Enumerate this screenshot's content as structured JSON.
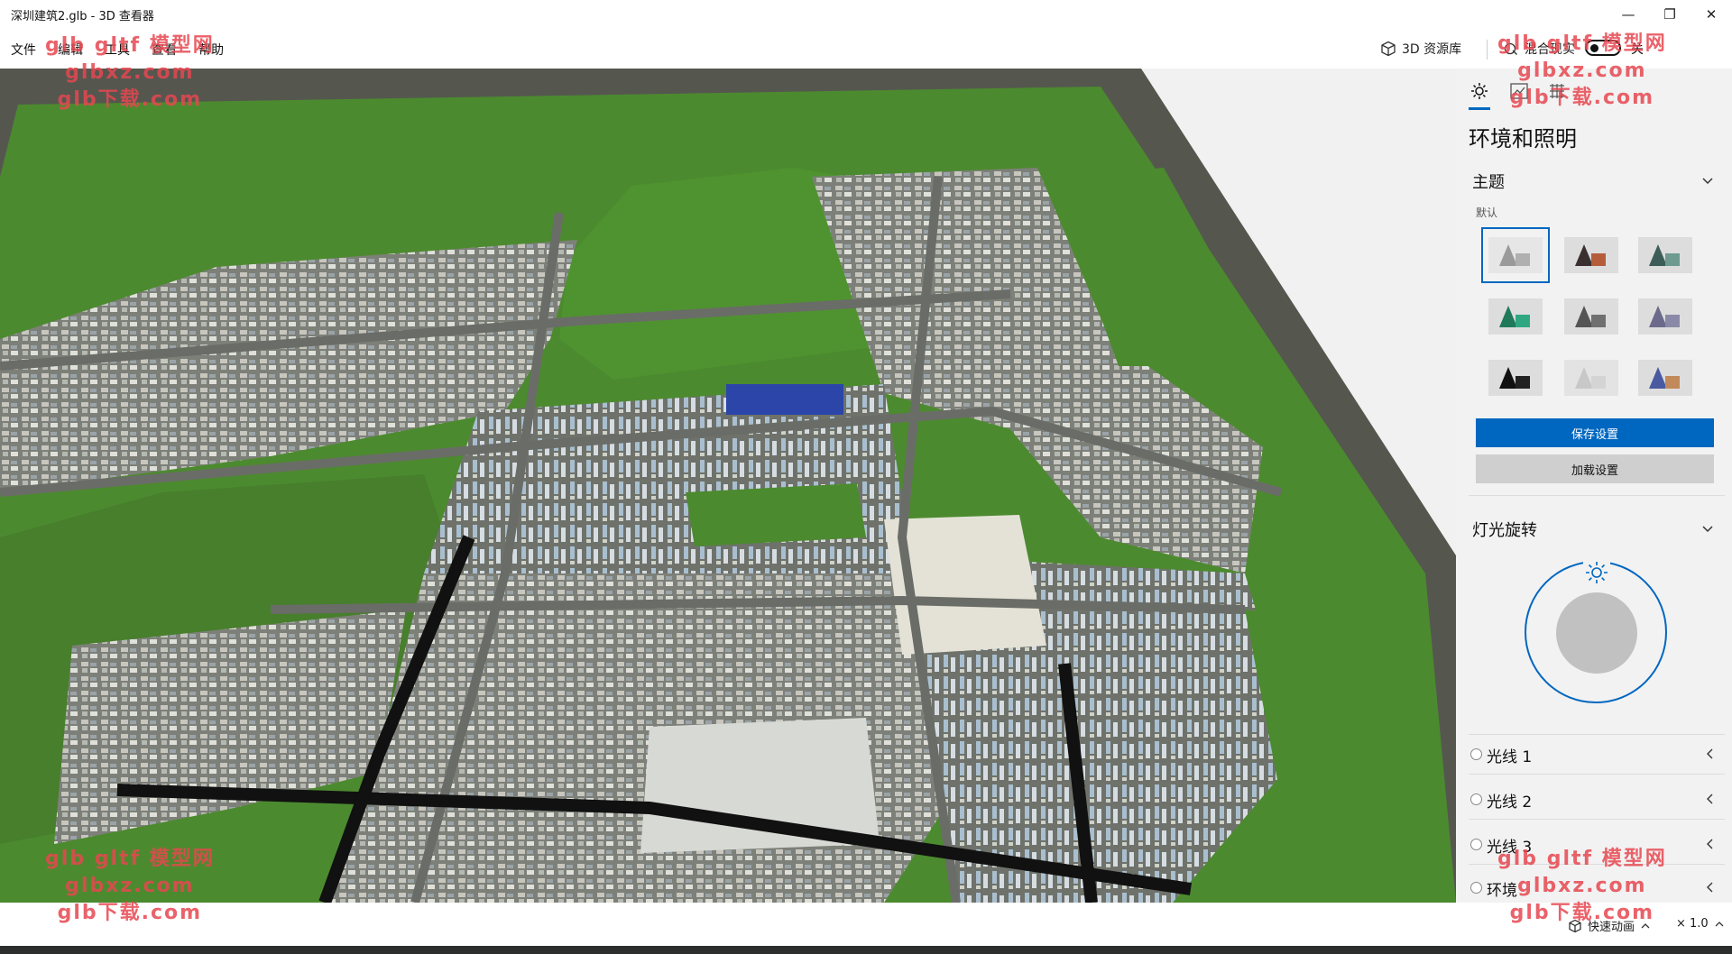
{
  "window": {
    "title": "深圳建筑2.glb - 3D 查看器",
    "controls": {
      "minimize": "—",
      "restore": "❐",
      "close": "✕"
    }
  },
  "menubar": {
    "items": [
      "文件",
      "编辑",
      "工具",
      "查看",
      "帮助"
    ],
    "library_label": "3D 资源库",
    "mixed_reality_label": "混合现实",
    "toggle_state": "关"
  },
  "panel": {
    "tabs": [
      {
        "icon": "sun-icon",
        "active": true
      },
      {
        "icon": "stats-icon",
        "active": false
      },
      {
        "icon": "grid-icon",
        "active": false
      }
    ],
    "title": "环境和照明",
    "theme": {
      "label": "主题",
      "default_label": "默认",
      "selected_index": 0
    },
    "save_button": "保存设置",
    "load_button": "加载设置",
    "light_rotation_label": "灯光旋转",
    "lights": [
      {
        "label": "光线 1"
      },
      {
        "label": "光线 2"
      },
      {
        "label": "光线 3"
      },
      {
        "label": "环境"
      }
    ]
  },
  "status": {
    "quick_animation": "快速动画",
    "speed": "× 1.0"
  },
  "watermark": {
    "line1": "glb gltf 模型网",
    "line2": "glbxz.com",
    "line3": "glb下载.com"
  },
  "colors": {
    "accent": "#0067c0",
    "grass": "#4a8a2e",
    "road": "#5a5d58",
    "ground_plane": "#55574f"
  }
}
